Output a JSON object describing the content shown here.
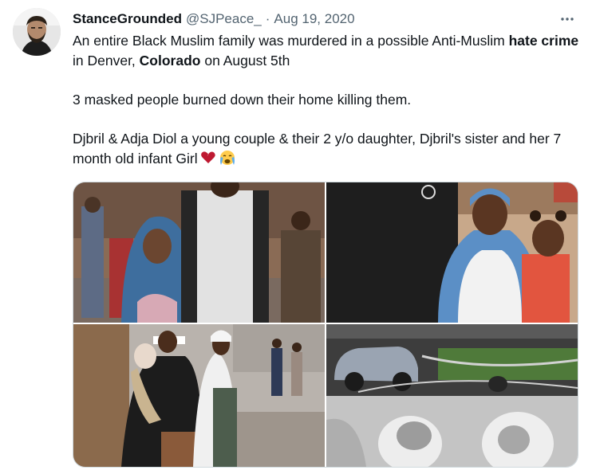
{
  "tweet": {
    "author": {
      "display_name": "StanceGrounded",
      "handle": "@SJPeace_"
    },
    "separator": "·",
    "date": "Aug 19, 2020",
    "more_icon": "more-horizontal-icon",
    "body": {
      "p1": {
        "s1": "An entire Black Muslim family was murdered in a possible Anti-Muslim ",
        "b1": "hate crime",
        "s2": " in Denver, ",
        "b2": "Colorado",
        "s3": " on August 5th"
      },
      "p2": "3 masked people burned down their home killing them.",
      "p3": "Djbril & Adja Diol a young couple & their 2 y/o daughter, Djbril's sister and her 7 month old infant Girl",
      "emojis": [
        "broken-heart-emoji",
        "crying-face-emoji"
      ]
    },
    "media": {
      "photos": [
        {
          "name": "family-photo-top-left"
        },
        {
          "name": "family-photo-top-right"
        },
        {
          "name": "family-photo-bottom-left"
        },
        {
          "name": "fire-scene-photo-bottom-right"
        }
      ]
    }
  },
  "colors": {
    "text": "#0f1419",
    "secondary": "#536471",
    "border": "#cfd9de",
    "background": "#ffffff"
  }
}
